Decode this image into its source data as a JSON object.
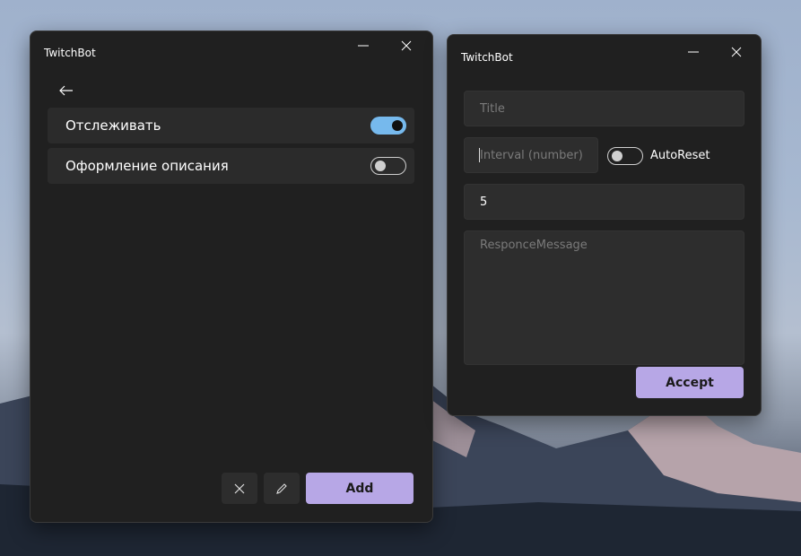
{
  "left_window": {
    "title": "TwitchBot",
    "settings": [
      {
        "label": "Отслеживать",
        "enabled": true
      },
      {
        "label": "Оформление описания",
        "enabled": false
      }
    ],
    "add_label": "Add"
  },
  "right_window": {
    "title": "TwitchBot",
    "title_placeholder": "Title",
    "interval_placeholder": "Interval (number)",
    "autoreset_label": "AutoReset",
    "autoreset_enabled": false,
    "value_field": "5",
    "message_placeholder": "ResponceMessage",
    "accept_label": "Accept"
  },
  "colors": {
    "window_bg": "#202020",
    "accent_button": "#b7a7e6",
    "toggle_on": "#76b9ed"
  }
}
